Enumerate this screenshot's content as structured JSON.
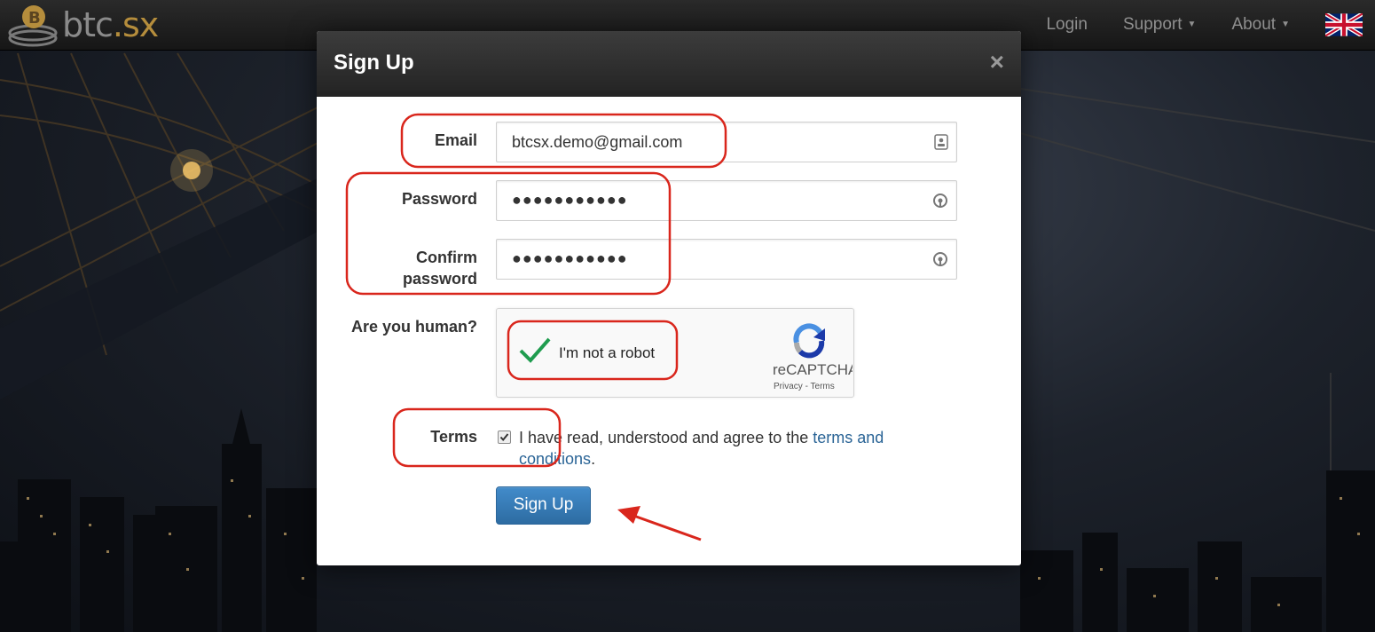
{
  "brand": {
    "name_part1": "btc",
    "name_part2": ".sx"
  },
  "nav": {
    "login": "Login",
    "support": "Support",
    "about": "About",
    "language_icon": "uk-flag-icon"
  },
  "modal": {
    "title": "Sign Up",
    "close_label": "×",
    "email": {
      "label": "Email",
      "value": "btcsx.demo@gmail.com"
    },
    "password": {
      "label": "Password",
      "value": "●●●●●●●●●●●"
    },
    "confirm_password": {
      "label_line1": "Confirm",
      "label_line2": "password",
      "value": "●●●●●●●●●●●"
    },
    "human": {
      "label": "Are you human?",
      "captcha_label": "I'm not a robot",
      "captcha_brand": "reCAPTCHA",
      "captcha_privacy": "Privacy",
      "captcha_sep": " - ",
      "captcha_terms": "Terms",
      "checked": true
    },
    "terms": {
      "label": "Terms",
      "text_before": "I have read, understood and agree to the ",
      "link_text": "terms and conditions",
      "text_after": ".",
      "checked": true
    },
    "submit_label": "Sign Up"
  },
  "colors": {
    "annotation": "#d9261c",
    "primary_button": "#3278b5",
    "link": "#2a6496",
    "brand_accent": "#b58d3c"
  }
}
